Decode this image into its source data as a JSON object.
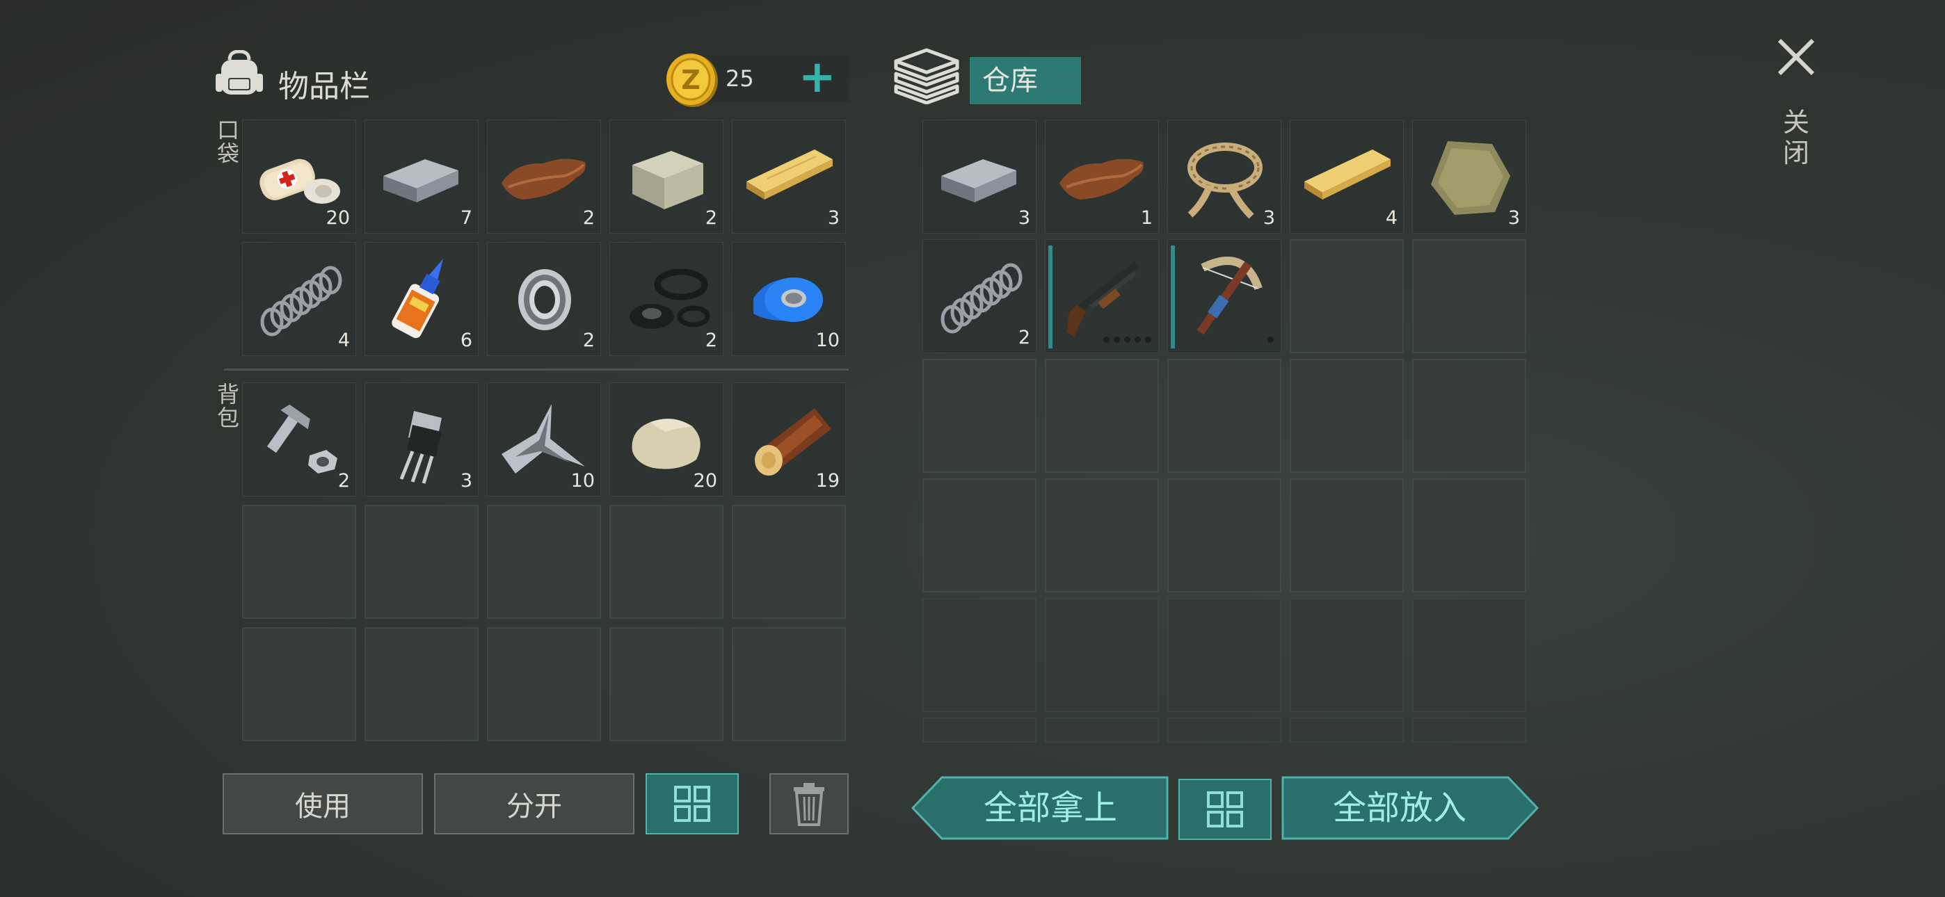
{
  "inventory": {
    "title": "物品栏",
    "currency": {
      "amount": "25",
      "add_label": "+"
    },
    "pocket_label": "口袋",
    "backpack_label": "背包",
    "pocket_rows": [
      [
        {
          "name": "bandage",
          "count": "20"
        },
        {
          "name": "iron-bar",
          "count": "7"
        },
        {
          "name": "leather",
          "count": "2"
        },
        {
          "name": "stone-block",
          "count": "2"
        },
        {
          "name": "wood-plank",
          "count": "3"
        }
      ],
      [
        {
          "name": "spring",
          "count": "4"
        },
        {
          "name": "glue",
          "count": "6"
        },
        {
          "name": "bearing",
          "count": "2"
        },
        {
          "name": "rubber-rings",
          "count": "2"
        },
        {
          "name": "blue-tape",
          "count": "10"
        }
      ]
    ],
    "backpack_rows": [
      [
        {
          "name": "bolt-nut",
          "count": "2"
        },
        {
          "name": "transistor",
          "count": "3"
        },
        {
          "name": "scrap-metal",
          "count": "10"
        },
        {
          "name": "rock",
          "count": "20"
        },
        {
          "name": "log",
          "count": "19"
        }
      ]
    ],
    "buttons": {
      "use": "使用",
      "split": "分开"
    }
  },
  "storage": {
    "title": "仓库",
    "rows": [
      [
        {
          "name": "iron-bar",
          "count": "3"
        },
        {
          "name": "leather",
          "count": "1"
        },
        {
          "name": "rope",
          "count": "3"
        },
        {
          "name": "wood-plank",
          "count": "4"
        },
        {
          "name": "cloth",
          "count": "3"
        }
      ],
      [
        {
          "name": "spring",
          "count": "2"
        },
        {
          "name": "shotgun",
          "count": ""
        },
        {
          "name": "crossbow",
          "count": ""
        }
      ]
    ],
    "buttons": {
      "take_all": "全部拿上",
      "put_all": "全部放入"
    }
  },
  "close_label": "关闭",
  "colors": {
    "accent": "#2b6f6c",
    "accent_border": "#4fb3ad",
    "storage_title_bg": "#2c7a73"
  }
}
